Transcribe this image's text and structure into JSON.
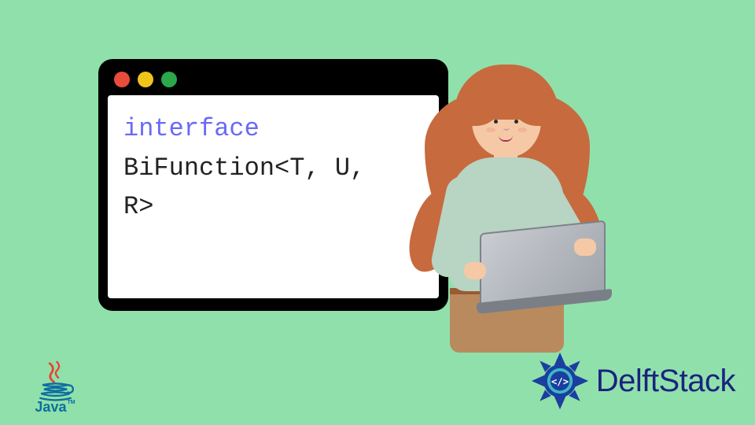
{
  "code": {
    "keyword": "interface",
    "line2": "BiFunction<T, U,",
    "line3": "R>"
  },
  "java": {
    "label": "Java",
    "tm": "TM"
  },
  "brand": {
    "name": "DelftStack"
  },
  "window_dots": {
    "red": "red",
    "yellow": "yellow",
    "green": "green"
  }
}
